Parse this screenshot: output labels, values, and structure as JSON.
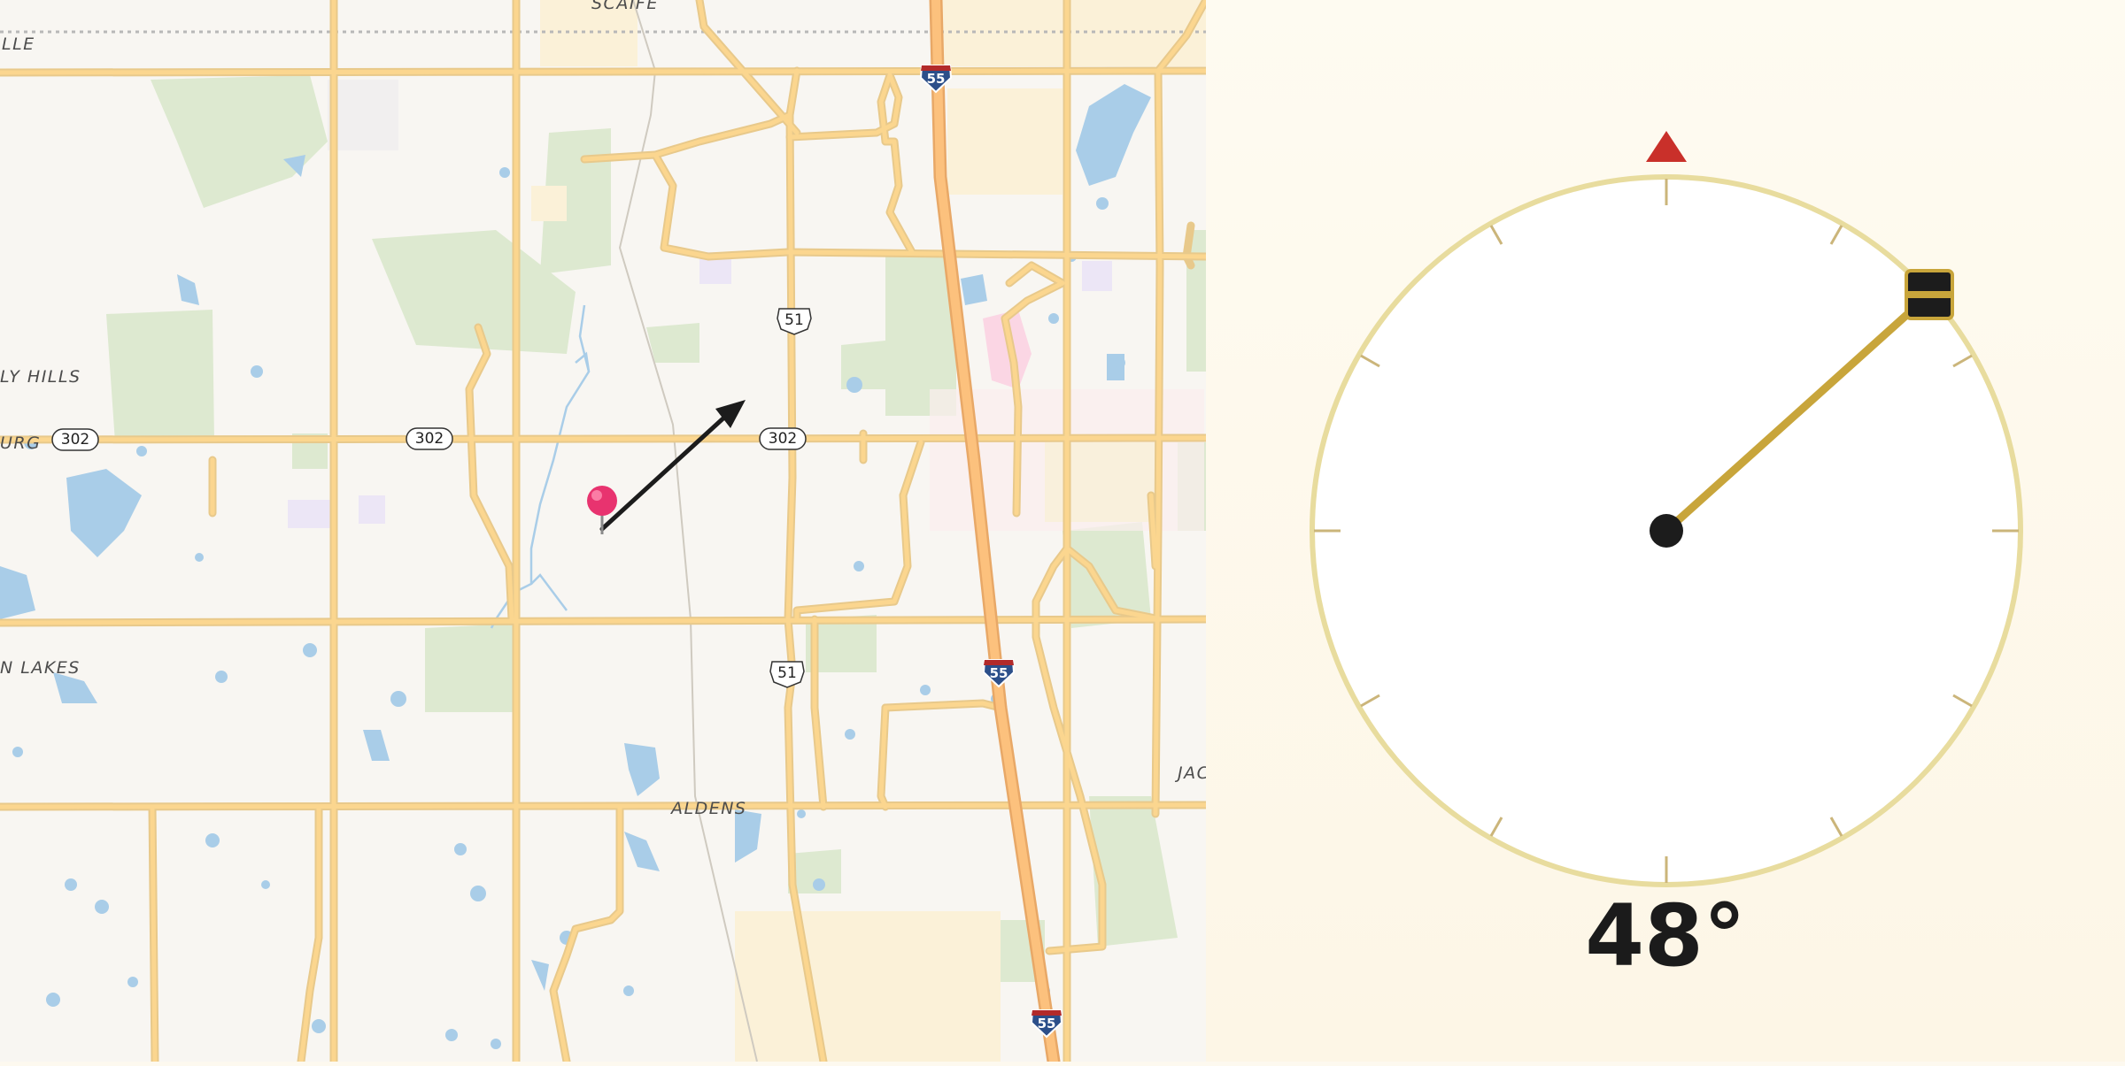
{
  "map": {
    "place_labels": {
      "scaife": "SCAIFE",
      "lle": "LLE",
      "ly_hills": "LY HILLS",
      "urg": "URG",
      "n_lakes": "N LAKES",
      "aldens": "ALDENS",
      "jac": "JAC"
    },
    "route_shields": {
      "r302_a": "302",
      "r302_b": "302",
      "r302_c": "302",
      "us51_a": "51",
      "us51_b": "51",
      "i55_a": "55",
      "i55_b": "55",
      "i55_c": "55"
    },
    "marker_icon": "pink-map-pin-icon",
    "direction_arrow_icon": "black-arrow-icon"
  },
  "compass": {
    "heading_degrees": 48,
    "heading_text": "48°",
    "north_marker_icon": "red-triangle-north-icon",
    "handle_icon": "drag-handle-icon",
    "colors": {
      "needle": "#c8a53b",
      "ring": "#e8dc9e",
      "north": "#c9302a",
      "hub": "#1c1c1c"
    }
  }
}
